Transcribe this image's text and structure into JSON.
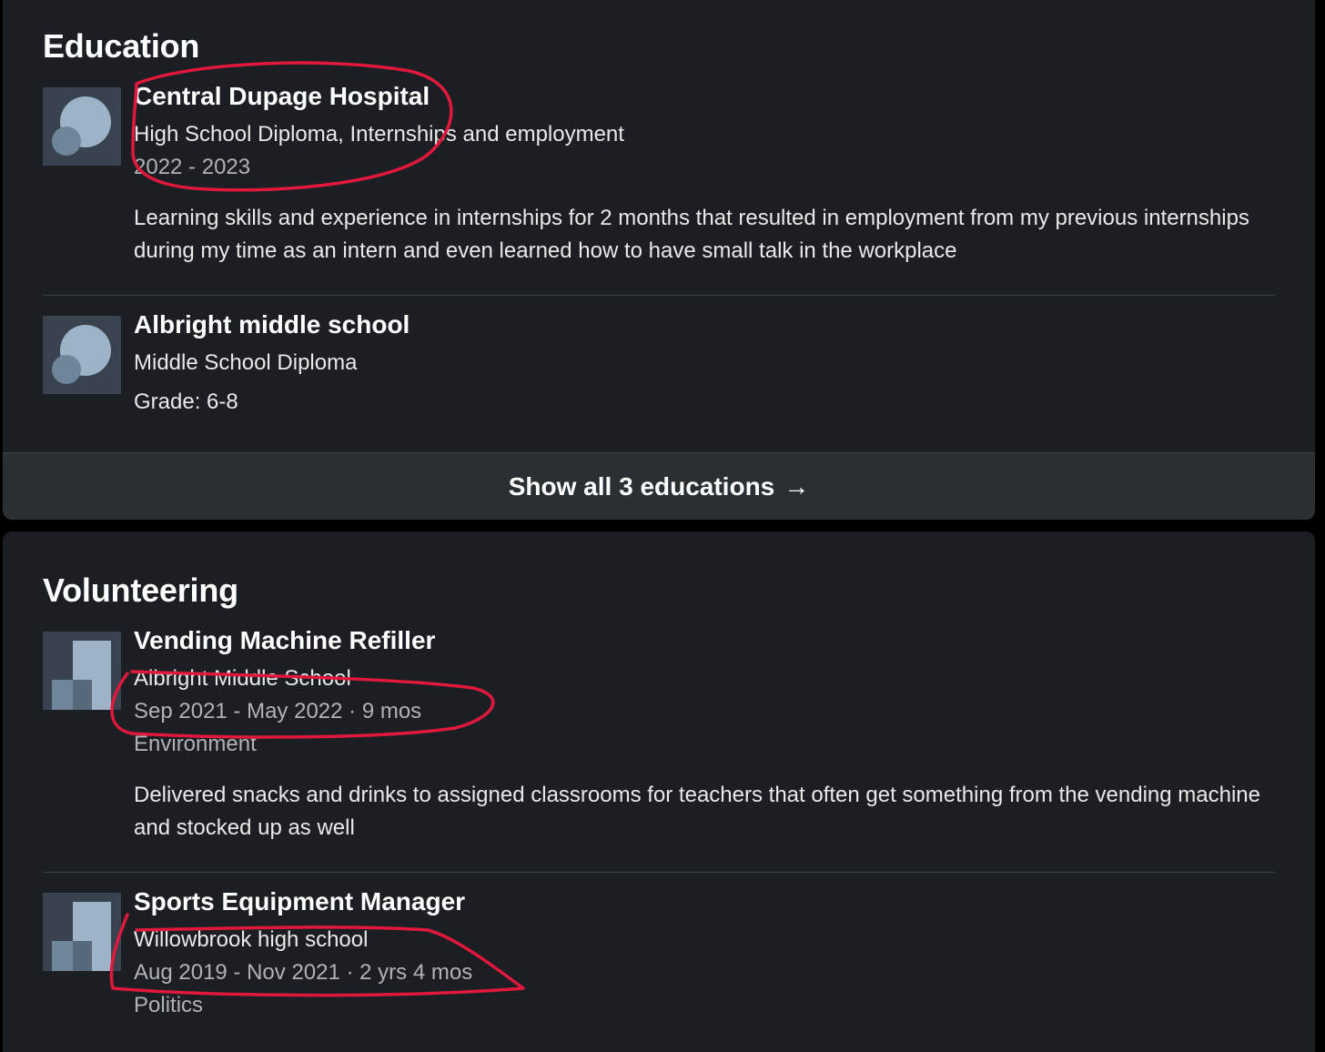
{
  "education": {
    "heading": "Education",
    "items": [
      {
        "school": "Central Dupage Hospital",
        "degree": "High School Diploma, Internships and employment",
        "dates": "2022 - 2023",
        "description": "Learning skills and experience in internships for 2 months that resulted in employment from my previous internships during my time as an intern and even learned how to have small talk in the workplace",
        "logo_icon": "school-placeholder-icon"
      },
      {
        "school": "Albright middle school",
        "degree": "Middle School Diploma",
        "grade": "Grade: 6-8",
        "logo_icon": "school-placeholder-icon"
      }
    ],
    "show_all_label": "Show all 3 educations",
    "show_all_arrow": "→"
  },
  "volunteering": {
    "heading": "Volunteering",
    "items": [
      {
        "role": "Vending Machine Refiller",
        "organization": "Albright Middle School",
        "dates": "Sep 2021 - May 2022 · 9 mos",
        "cause": "Environment",
        "description": "Delivered snacks and drinks to assigned classrooms for teachers that often get something from the vending machine and stocked up as well",
        "logo_icon": "company-placeholder-icon"
      },
      {
        "role": "Sports Equipment Manager",
        "organization": "Willowbrook high school",
        "dates": "Aug 2019 - Nov 2021 · 2 yrs 4 mos",
        "cause": "Politics",
        "logo_icon": "company-placeholder-icon"
      }
    ]
  },
  "colors": {
    "background": "#000000",
    "card": "#1b1f23",
    "show_all_bar": "#2a2f33",
    "annotation": "#e0183c"
  }
}
